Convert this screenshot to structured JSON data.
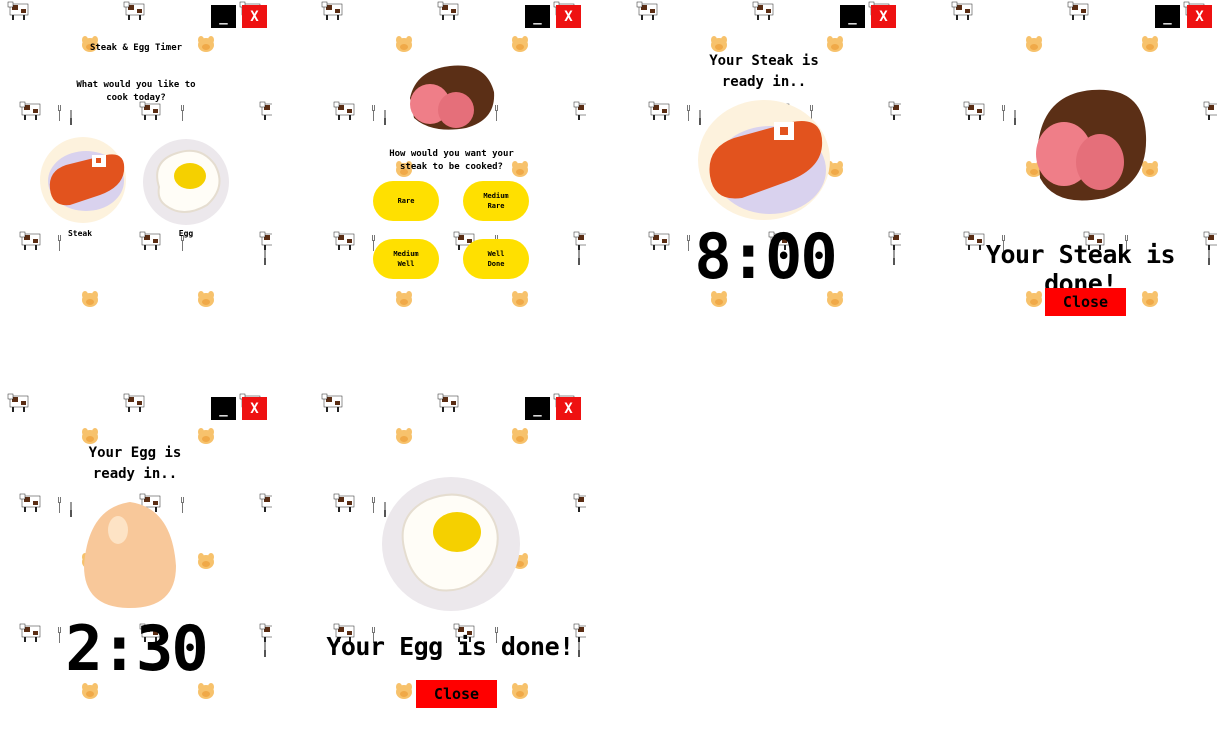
{
  "window": {
    "minimize_label": "_",
    "close_label": "X"
  },
  "icons": [
    "chick-icon",
    "cow-icon",
    "fork-icon",
    "knife-icon",
    "steak-icon",
    "egg-icon",
    "fried-egg-icon",
    "sliced-steak-icon"
  ],
  "screen1": {
    "title": "Steak & Egg Timer",
    "question": "What would you like to cook today?",
    "options": [
      {
        "label": "Steak"
      },
      {
        "label": "Egg"
      }
    ]
  },
  "screen2": {
    "question": "How would you want your steak to be cooked?",
    "doneness": [
      {
        "label": "Rare"
      },
      {
        "label": "Medium\nRare"
      },
      {
        "label": "Medium\nWell"
      },
      {
        "label": "Well\nDone"
      }
    ]
  },
  "screen3": {
    "title": "Your Steak is ready in..",
    "timer": "8:00"
  },
  "screen4": {
    "message": "Your Steak is done!",
    "close_label": "Close"
  },
  "screen5": {
    "title": "Your Egg is ready in..",
    "timer": "2:30"
  },
  "screen6": {
    "message": "Your Egg is done!",
    "close_label": "Close"
  },
  "colors": {
    "close": "#ee1111",
    "pill": "#ffe000",
    "steak": "#e2531e",
    "yolk": "#f5d000"
  }
}
